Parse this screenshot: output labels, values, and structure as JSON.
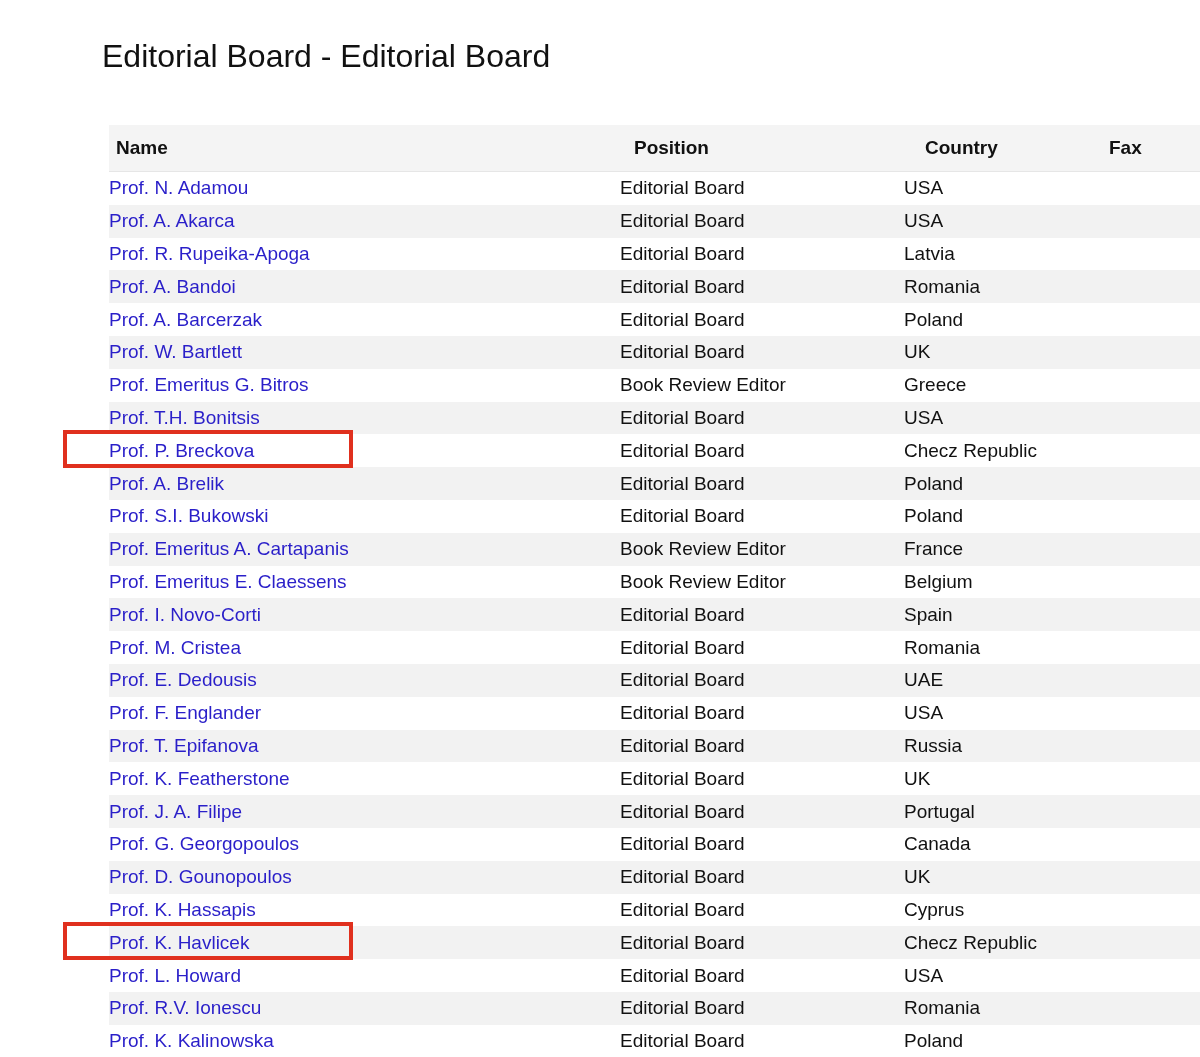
{
  "title": "Editorial Board - Editorial Board",
  "table": {
    "columns": [
      "Name",
      "Position",
      "Country",
      "Fax"
    ],
    "rows": [
      {
        "name": "Prof. N. Adamou",
        "position": "Editorial Board",
        "country": "USA",
        "highlighted": false
      },
      {
        "name": "Prof. A. Akarca",
        "position": "Editorial Board",
        "country": "USA",
        "highlighted": false
      },
      {
        "name": "Prof. R. Rupeika-Apoga",
        "position": "Editorial Board",
        "country": "Latvia",
        "highlighted": false
      },
      {
        "name": "Prof. A. Bandoi",
        "position": "Editorial Board",
        "country": "Romania",
        "highlighted": false
      },
      {
        "name": "Prof. A. Barcerzak",
        "position": "Editorial Board",
        "country": "Poland",
        "highlighted": false
      },
      {
        "name": "Prof. W. Bartlett",
        "position": "Editorial Board",
        "country": "UK",
        "highlighted": false
      },
      {
        "name": "Prof. Emeritus G. Bitros",
        "position": "Book Review Editor",
        "country": "Greece",
        "highlighted": false
      },
      {
        "name": "Prof. T.H. Bonitsis",
        "position": "Editorial Board",
        "country": "USA",
        "highlighted": false
      },
      {
        "name": "Prof. P. Breckova",
        "position": "Editorial Board",
        "country": "Checz Republic",
        "highlighted": true
      },
      {
        "name": "Prof. A. Brelik",
        "position": "Editorial Board",
        "country": "Poland",
        "highlighted": false
      },
      {
        "name": "Prof. S.I. Bukowski",
        "position": "Editorial Board",
        "country": "Poland",
        "highlighted": false
      },
      {
        "name": "Prof. Emeritus A. Cartapanis",
        "position": "Book Review Editor",
        "country": "France",
        "highlighted": false
      },
      {
        "name": "Prof. Emeritus E. Claessens",
        "position": "Book Review Editor",
        "country": "Belgium",
        "highlighted": false
      },
      {
        "name": "Prof. I. Novo-Corti",
        "position": "Editorial Board",
        "country": "Spain",
        "highlighted": false
      },
      {
        "name": "Prof. M. Cristea",
        "position": "Editorial Board",
        "country": "Romania",
        "highlighted": false
      },
      {
        "name": "Prof. E. Dedousis",
        "position": "Editorial Board",
        "country": "UAE",
        "highlighted": false
      },
      {
        "name": "Prof. F. Englander",
        "position": "Editorial Board",
        "country": "USA",
        "highlighted": false
      },
      {
        "name": "Prof. T. Epifanova",
        "position": "Editorial Board",
        "country": "Russia",
        "highlighted": false
      },
      {
        "name": "Prof. K. Featherstone",
        "position": "Editorial Board",
        "country": "UK",
        "highlighted": false
      },
      {
        "name": "Prof. J. A. Filipe",
        "position": "Editorial Board",
        "country": "Portugal",
        "highlighted": false
      },
      {
        "name": "Prof. G. Georgopoulos",
        "position": "Editorial Board",
        "country": "Canada",
        "highlighted": false
      },
      {
        "name": "Prof. D. Gounopoulos",
        "position": "Editorial Board",
        "country": "UK",
        "highlighted": false
      },
      {
        "name": "Prof. K. Hassapis",
        "position": "Editorial Board",
        "country": "Cyprus",
        "highlighted": false
      },
      {
        "name": "Prof. K. Havlicek",
        "position": "Editorial Board",
        "country": "Checz Republic",
        "highlighted": true
      },
      {
        "name": "Prof. L. Howard",
        "position": "Editorial Board",
        "country": "USA",
        "highlighted": false
      },
      {
        "name": "Prof. R.V. Ionescu",
        "position": "Editorial Board",
        "country": "Romania",
        "highlighted": false
      },
      {
        "name": "Prof. K. Kalinowska",
        "position": "Editorial Board",
        "country": "Poland",
        "highlighted": false
      }
    ]
  }
}
